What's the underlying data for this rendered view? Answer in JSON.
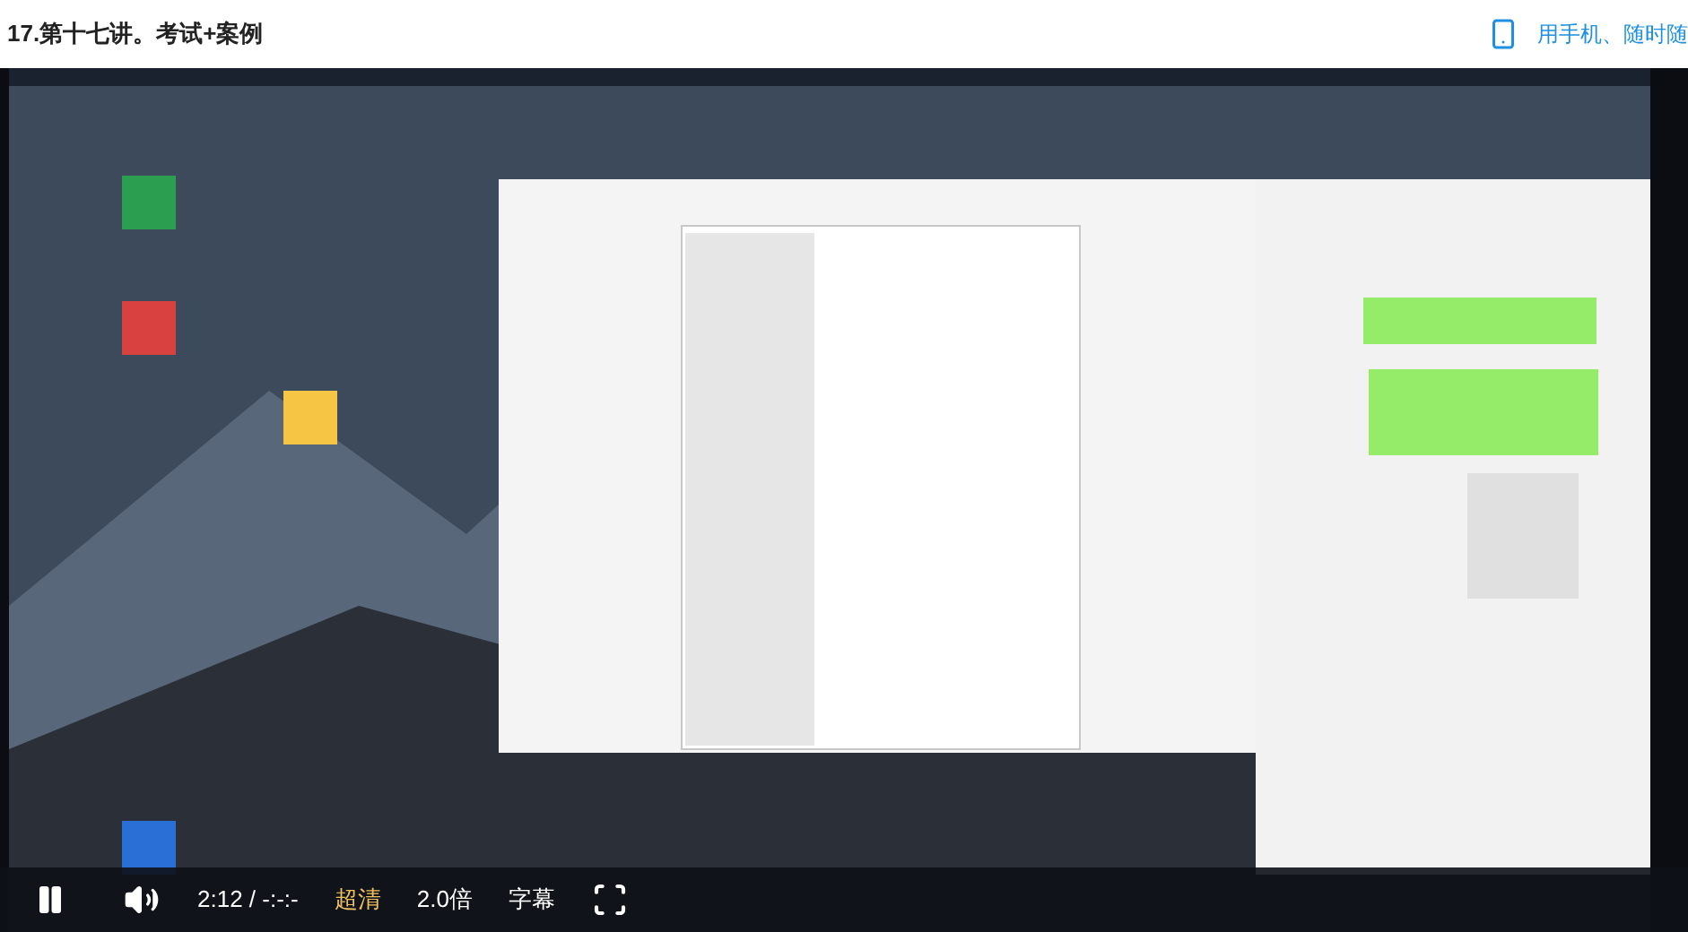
{
  "header": {
    "title": "17.第十七讲。考试+案例",
    "mobile_link": "用手机、随时随"
  },
  "controls": {
    "playing": true,
    "muted": false,
    "time": "2:12 / -:-:-",
    "quality": "超清",
    "speed": "2.0倍",
    "subtitles": "字幕"
  }
}
